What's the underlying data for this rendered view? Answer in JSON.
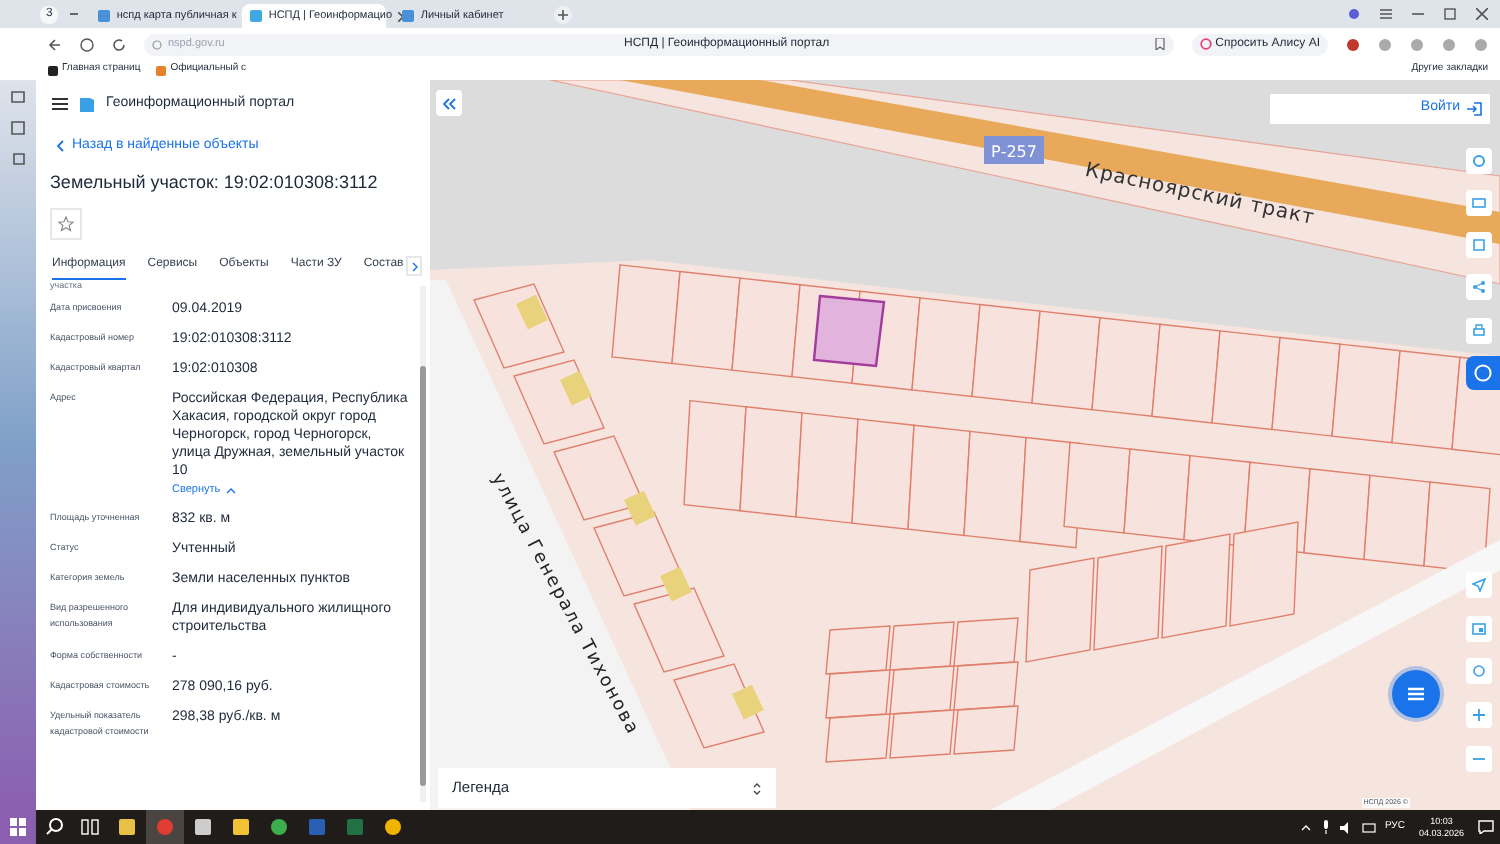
{
  "browser": {
    "tab_count": "3",
    "tabs": [
      {
        "label": "нспд карта публичная к",
        "selected": false
      },
      {
        "label": "НСПД | Геоинформацио",
        "selected": true
      },
      {
        "label": "Личный кабинет",
        "selected": false
      }
    ],
    "address": "nspd.gov.ru",
    "page_title": "НСПД | Геоинформационный портал",
    "assistant_button": "Спросить Алису AI",
    "bookmarks": [
      "Главная страниц",
      "Официальный с"
    ],
    "other_bookmarks": "Другие закладки"
  },
  "panel": {
    "portal_name": "Геоинформационный портал",
    "back_link": "Назад в найденные объекты",
    "title": "Земельный участок: 19:02:010308:3112",
    "tabs": [
      {
        "label": "Информация",
        "selected": true
      },
      {
        "label": "Сервисы",
        "selected": false
      },
      {
        "label": "Объекты",
        "selected": false
      },
      {
        "label": "Части ЗУ",
        "selected": false
      },
      {
        "label": "Состав",
        "selected": false
      }
    ],
    "cut_label": "участка",
    "fields": [
      {
        "label": "Дата присвоения",
        "value": "09.04.2019"
      },
      {
        "label": "Кадастровый номер",
        "value": "19:02:010308:3112"
      },
      {
        "label": "Кадастровый квартал",
        "value": "19:02:010308"
      },
      {
        "label": "Адрес",
        "value": "Российская Федерация, Республика Хакасия, городской округ город Черногорск, город Черногорск, улица Дружная, земельный участок 10",
        "link": "Свернуть"
      },
      {
        "label": "Площадь уточненная",
        "value": "832 кв. м"
      },
      {
        "label": "Статус",
        "value": "Учтенный"
      },
      {
        "label": "Категория земель",
        "value": "Земли населенных пунктов"
      },
      {
        "label": "Вид разрешенного использования",
        "value": "Для индивидуального жилищного строительства"
      },
      {
        "label": "Форма собственности",
        "value": "-"
      },
      {
        "label": "Кадастровая стоимость",
        "value": "278 090,16 руб."
      },
      {
        "label": "Удельный показатель кадастровой стоимости",
        "value": "298,38 руб./кв. м"
      }
    ]
  },
  "map": {
    "login": "Войти",
    "road_number": "Р-257",
    "road_name": "Красноярский тракт",
    "street_name": "улица Генерала Тихонова",
    "legend": "Легенда",
    "attribution": "НСПД 2026 ©"
  },
  "taskbar": {
    "language": "РУС",
    "time": "10:03",
    "date": "04.03.2026"
  }
}
